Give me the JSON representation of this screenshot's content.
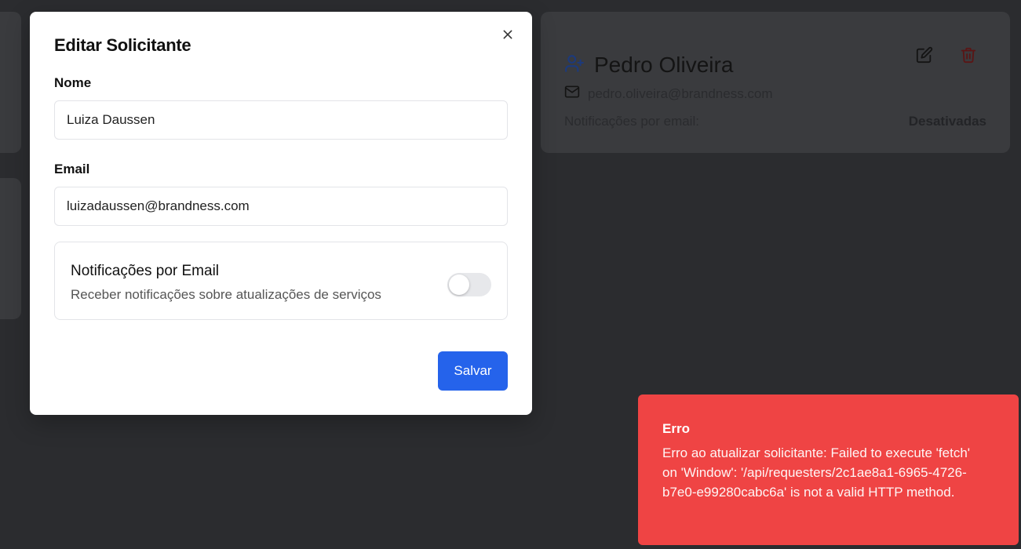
{
  "background_card": {
    "name": "Pedro Oliveira",
    "email": "pedro.oliveira@brandness.com",
    "notif_label": "Notificações por email:",
    "notif_value": "Desativadas",
    "icons": [
      "user-plus-icon",
      "mail-icon",
      "edit-icon",
      "trash-icon"
    ]
  },
  "modal": {
    "title": "Editar Solicitante",
    "name_label": "Nome",
    "name_value": "Luiza Daussen",
    "email_label": "Email",
    "email_value": "luizadaussen@brandness.com",
    "notifications": {
      "title": "Notificações por Email",
      "description": "Receber notificações sobre atualizações de serviços",
      "enabled": false
    },
    "save_label": "Salvar"
  },
  "toast": {
    "title": "Erro",
    "message": "Erro ao atualizar solicitante: Failed to execute 'fetch' on 'Window': '/api/requesters/2c1ae8a1-6965-4726-b7e0-e99280cabc6a' is not a valid HTTP method."
  },
  "colors": {
    "overlay_bg": "#2b2c2f",
    "primary": "#2563eb",
    "error": "#ef4444",
    "delete": "#b91c1c"
  }
}
